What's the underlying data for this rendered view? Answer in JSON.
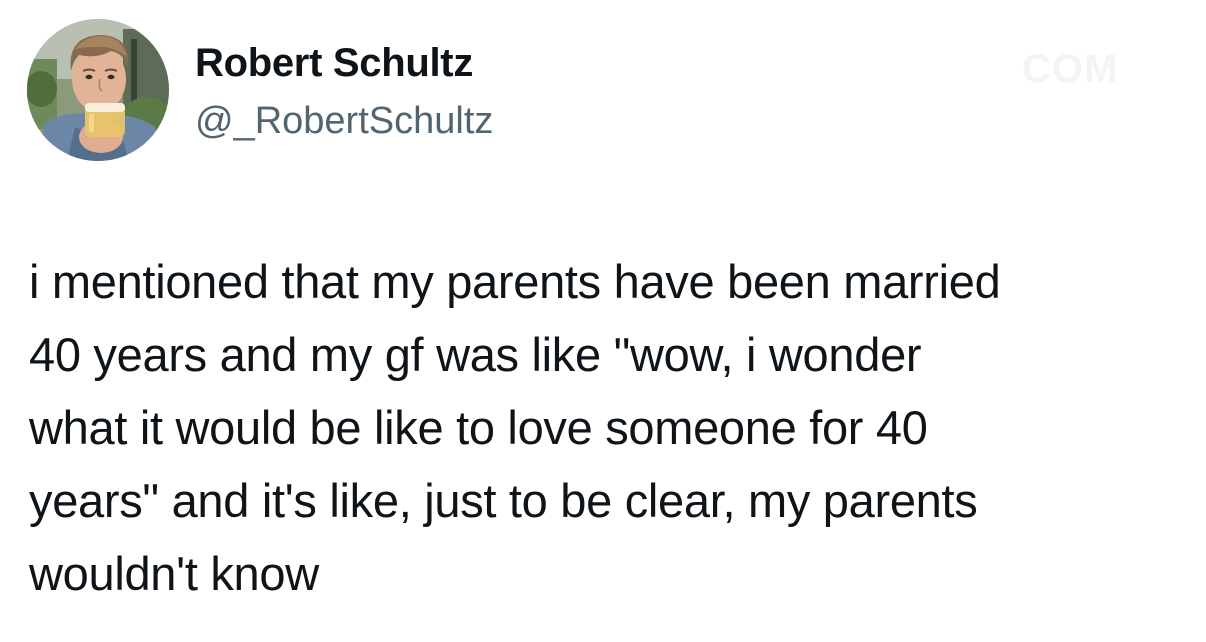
{
  "author": {
    "display_name": "Robert Schultz",
    "handle": "@_RobertSchultz",
    "avatar_icon": "profile-photo-avatar"
  },
  "watermark": "COM",
  "tweet": {
    "text_lines": [
      "i mentioned that my parents have been married",
      "40 years and my gf was like \"wow, i wonder",
      "what it would be like to love someone for 40",
      "years\" and it's like, just to be clear, my parents",
      "wouldn't know"
    ]
  },
  "colors": {
    "name": "#0f1419",
    "handle": "#536471",
    "body_text": "#0f1419",
    "background": "#ffffff"
  }
}
